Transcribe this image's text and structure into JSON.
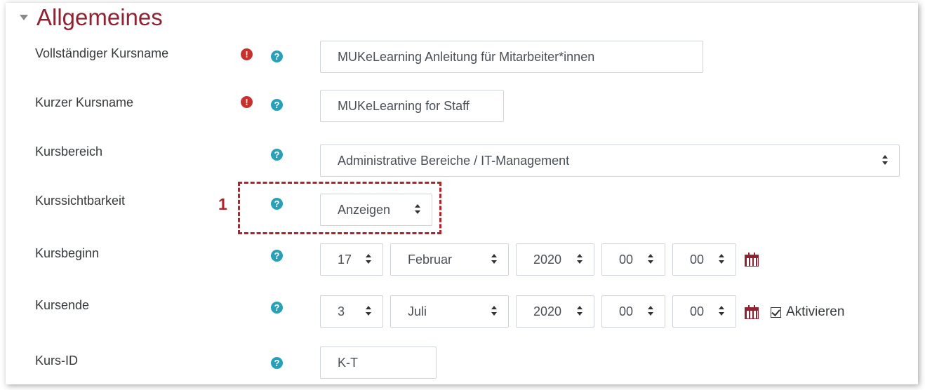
{
  "section": {
    "title": "Allgemeines"
  },
  "fields": {
    "fullname": {
      "label": "Vollständiger Kursname",
      "value": "MUKeLearning Anleitung für Mitarbeiter*innen"
    },
    "shortname": {
      "label": "Kurzer Kursname",
      "value": "MUKeLearning for Staff"
    },
    "category": {
      "label": "Kursbereich",
      "value": "Administrative Bereiche / IT-Management"
    },
    "visibility": {
      "label": "Kurssichtbarkeit",
      "value": "Anzeigen"
    },
    "startdate": {
      "label": "Kursbeginn",
      "day": "17",
      "month": "Februar",
      "year": "2020",
      "hour": "00",
      "minute": "00"
    },
    "enddate": {
      "label": "Kursende",
      "day": "3",
      "month": "Juli",
      "year": "2020",
      "hour": "00",
      "minute": "00",
      "enable_label": "Aktivieren",
      "enabled": true
    },
    "idnumber": {
      "label": "Kurs-ID",
      "value": "K-T"
    }
  },
  "annotation": {
    "number": "1"
  },
  "icons": {
    "required": "exclamation-circle-icon",
    "help": "question-circle-icon",
    "calendar": "calendar-icon"
  },
  "colors": {
    "heading": "#8f2332",
    "required": "#c9302c",
    "help": "#27a0b8",
    "annotation": "#b0232a"
  }
}
